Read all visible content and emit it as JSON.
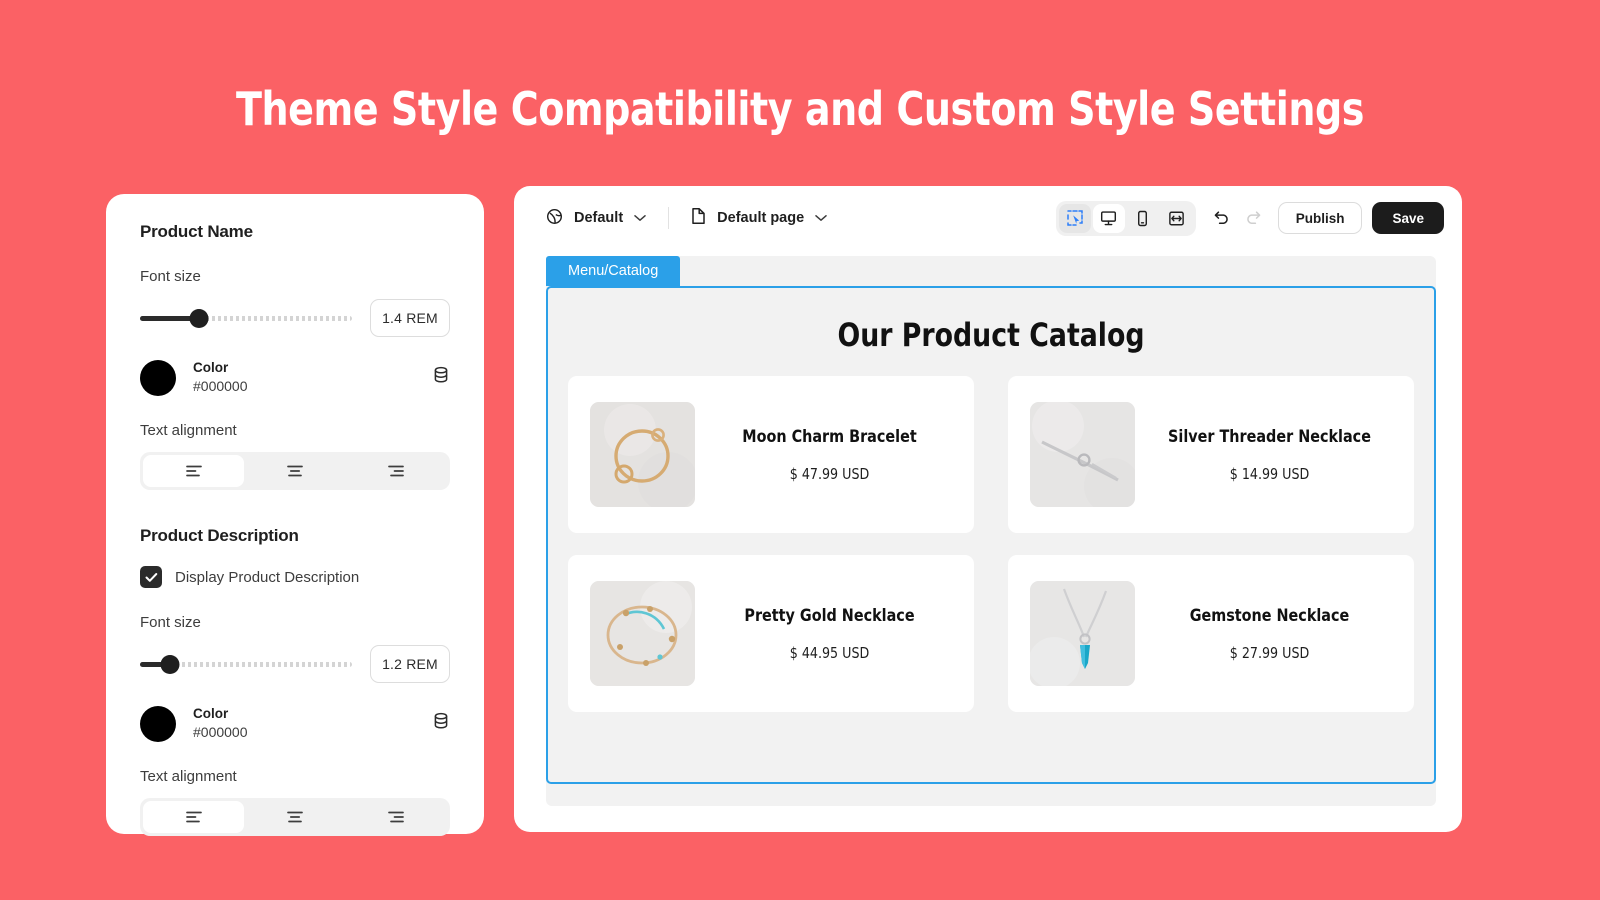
{
  "page": {
    "title": "Theme Style Compatibility and Custom Style Settings",
    "background_color": "#fb6165"
  },
  "settings_panel": {
    "sections": [
      {
        "heading": "Product Name",
        "font_size_label": "Font size",
        "font_size_value": "1.4 REM",
        "slider_percent": 28,
        "color_label": "Color",
        "color_hex": "#000000",
        "alignment_label": "Text alignment",
        "alignment_selected": "left",
        "alignment_options": [
          "left",
          "center",
          "right"
        ]
      },
      {
        "heading": "Product Description",
        "checkbox_label": "Display Product Description",
        "checkbox_checked": true,
        "font_size_label": "Font size",
        "font_size_value": "1.2 REM",
        "slider_percent": 14,
        "color_label": "Color",
        "color_hex": "#000000",
        "alignment_label": "Text alignment",
        "alignment_selected": "left",
        "alignment_options": [
          "left",
          "center",
          "right"
        ]
      }
    ]
  },
  "editor": {
    "toolbar": {
      "theme_selector": "Default",
      "page_selector": "Default page",
      "device_buttons": [
        "select-cursor",
        "desktop",
        "mobile",
        "responsive"
      ],
      "active_device": "desktop",
      "selected_tool": "select-cursor",
      "undo_enabled": true,
      "redo_enabled": false,
      "publish_label": "Publish",
      "save_label": "Save"
    },
    "canvas": {
      "selection_tab_label": "Menu/Catalog",
      "selection_color": "#2ba0e8",
      "catalog_title": "Our Product Catalog",
      "products": [
        {
          "name": "Moon Charm Bracelet",
          "price": "$ 47.99 USD",
          "image": "gold-bracelet"
        },
        {
          "name": "Silver Threader Necklace",
          "price": "$ 14.99 USD",
          "image": "silver-threader"
        },
        {
          "name": "Pretty Gold Necklace",
          "price": "$ 44.95 USD",
          "image": "gold-necklace"
        },
        {
          "name": "Gemstone Necklace",
          "price": "$ 27.99 USD",
          "image": "gemstone-necklace"
        }
      ]
    }
  }
}
